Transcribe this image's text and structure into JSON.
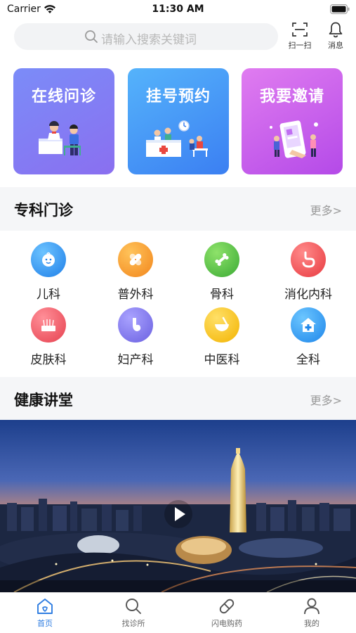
{
  "status": {
    "carrier": "Carrier",
    "time": "11:30 AM"
  },
  "search": {
    "placeholder": "请输入搜索关键词"
  },
  "top_actions": {
    "scan": "扫一扫",
    "message": "消息"
  },
  "cards": [
    {
      "title": "在线问诊",
      "illustration": "doctor-consult-icon"
    },
    {
      "title": "挂号预约",
      "illustration": "registration-desk-icon"
    },
    {
      "title": "我要邀请",
      "illustration": "invite-phone-icon"
    }
  ],
  "specialty": {
    "title": "专科门诊",
    "more": "更多>",
    "items": [
      {
        "label": "儿科",
        "icon": "baby-face-icon",
        "color": "#2f8df0"
      },
      {
        "label": "普外科",
        "icon": "bandage-icon",
        "color": "#f5962a"
      },
      {
        "label": "骨科",
        "icon": "bone-icon",
        "color": "#4fbf3f"
      },
      {
        "label": "消化内科",
        "icon": "stomach-icon",
        "color": "#f0505a"
      },
      {
        "label": "皮肤科",
        "icon": "skin-icon",
        "color": "#ef4f5f"
      },
      {
        "label": "妇产科",
        "icon": "uterus-icon",
        "color": "#7b73e8"
      },
      {
        "label": "中医科",
        "icon": "mortar-icon",
        "color": "#f6c21c"
      },
      {
        "label": "全科",
        "icon": "clinic-house-icon",
        "color": "#2a93ef"
      }
    ]
  },
  "health": {
    "title": "健康讲堂",
    "more": "更多>"
  },
  "tabs": [
    {
      "label": "首页",
      "icon": "home-icon",
      "active": true
    },
    {
      "label": "找诊所",
      "icon": "search-icon",
      "active": false
    },
    {
      "label": "闪电购药",
      "icon": "pill-icon",
      "active": false
    },
    {
      "label": "我的",
      "icon": "user-icon",
      "active": false
    }
  ],
  "colors": {
    "accent": "#2f7de1"
  }
}
